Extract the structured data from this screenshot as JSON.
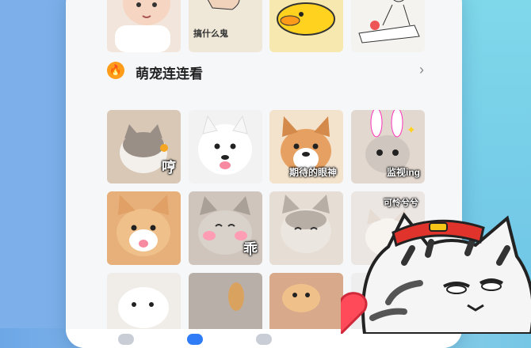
{
  "section": {
    "title": "萌宠连连看",
    "chevron": "›"
  },
  "top_row": [
    {
      "caption": "",
      "color": "#f2e6dc"
    },
    {
      "caption": "搞什么鬼",
      "color": "#efe8d8"
    },
    {
      "caption": "",
      "color": "#f7d98a"
    },
    {
      "caption": "",
      "color": "#f3f0ec"
    }
  ],
  "grid": [
    {
      "caption": "哼",
      "style": "big",
      "color": "#d9c8b6"
    },
    {
      "caption": "",
      "style": "",
      "color": "#f2f2f2"
    },
    {
      "caption": "期待的眼神",
      "style": "",
      "color": "#e9c7a4"
    },
    {
      "caption": "监视ing",
      "style": "",
      "color": "#e3d8cf"
    },
    {
      "caption": "",
      "style": "",
      "color": "#e7b07a"
    },
    {
      "caption": "乖",
      "style": "big",
      "color": "#cfc5bd"
    },
    {
      "caption": "",
      "style": "",
      "color": "#e6ddd4"
    },
    {
      "caption": "可怜兮兮",
      "style": "top",
      "color": "#ece6e2"
    },
    {
      "caption": "",
      "style": "",
      "color": "#f0ece8"
    },
    {
      "caption": "",
      "style": "",
      "color": "#b8b0a8"
    },
    {
      "caption": "",
      "style": "",
      "color": "#d8a98a"
    },
    {
      "caption": "",
      "style": "",
      "color": "#eeeeee"
    }
  ],
  "icons": {
    "fire": "🔥"
  }
}
